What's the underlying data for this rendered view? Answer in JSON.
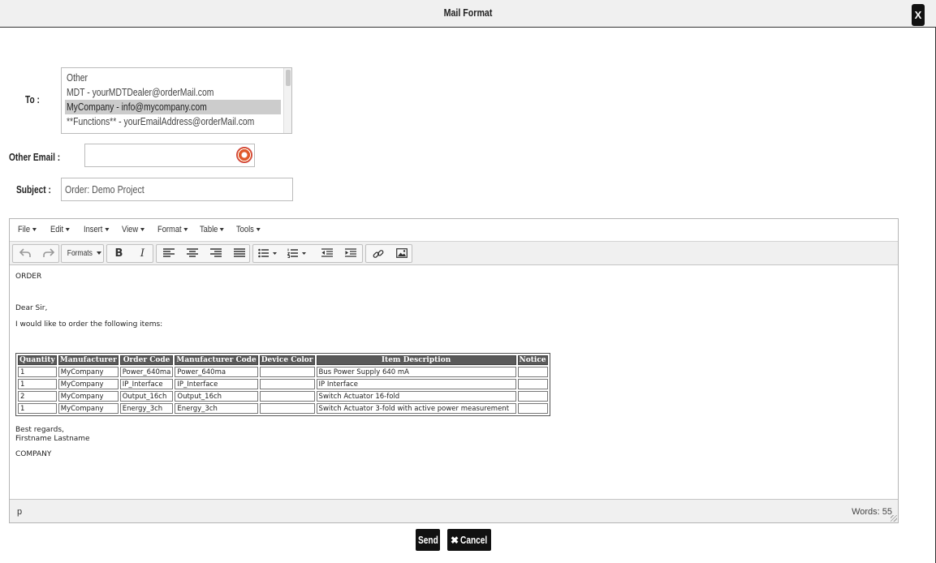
{
  "dialog": {
    "title": "Mail Format",
    "close_label": "X"
  },
  "form": {
    "to_label": "To :",
    "to_options": [
      "Other",
      "MDT - yourMDTDealer@orderMail.com",
      "MyCompany - info@mycompany.com",
      "**Functions** - yourEmailAddress@orderMail.com"
    ],
    "to_selected": "MyCompany - info@mycompany.com",
    "other_email_label": "Other Email :",
    "other_email_value": "",
    "subject_label": "Subject :",
    "subject_value": "Order: Demo Project"
  },
  "editor": {
    "menus": [
      "File",
      "Edit",
      "Insert",
      "View",
      "Format",
      "Table",
      "Tools"
    ],
    "toolbar": {
      "formats_label": "Formats",
      "bold": "B",
      "italic": "I"
    },
    "content": {
      "heading": "ORDER",
      "greeting": "Dear Sir,",
      "intro": "I would like to order the following items:",
      "table": {
        "headers": [
          "Quantity",
          "Manufacturer",
          "Order Code",
          "Manufacturer Code",
          "Device Color",
          "Item Description",
          "Notice"
        ],
        "rows": [
          [
            "1",
            "MyCompany",
            "Power_640ma",
            "Power_640ma",
            "",
            "Bus Power Supply 640 mA",
            ""
          ],
          [
            "1",
            "MyCompany",
            "IP_Interface",
            "IP_Interface",
            "",
            "IP Interface",
            ""
          ],
          [
            "2",
            "MyCompany",
            "Output_16ch",
            "Output_16ch",
            "",
            "Switch Actuator 16-fold",
            ""
          ],
          [
            "1",
            "MyCompany",
            "Energy_3ch",
            "Energy_3ch",
            "",
            "Switch Actuator 3-fold with active power measurement",
            ""
          ]
        ]
      },
      "closing": "Best regards,",
      "signature_name": "Firstname Lastname",
      "company": "COMPANY"
    },
    "status_path": "p",
    "word_count": "Words: 55"
  },
  "actions": {
    "send_label": "Send",
    "cancel_label": "Cancel"
  }
}
